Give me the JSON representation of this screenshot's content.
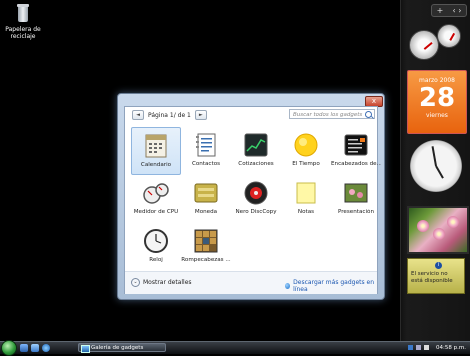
{
  "desktop": {
    "recycle_bin_label": "Papelera de reciclaje"
  },
  "sidebar": {
    "controls": {
      "add": "+",
      "nav": "‹ ›"
    },
    "calendar": {
      "month": "marzo 2008",
      "day": "28",
      "weekday": "viernes"
    },
    "weather_message": "El servicio no está disponible"
  },
  "gallery": {
    "close_label": "x",
    "pager": {
      "prev": "◄",
      "label": "Página 1/ de 1",
      "next": "►"
    },
    "search_placeholder": "Buscar todos los gadgets",
    "gadgets": [
      {
        "name": "Calendario",
        "icon": "calendar-icon",
        "selected": true
      },
      {
        "name": "Contactos",
        "icon": "contacts-icon",
        "selected": false
      },
      {
        "name": "Cotizaciones",
        "icon": "stocks-icon",
        "selected": false
      },
      {
        "name": "El Tiempo",
        "icon": "weather-icon",
        "selected": false
      },
      {
        "name": "Encabezados de...",
        "icon": "headlines-icon",
        "selected": false
      },
      {
        "name": "Medidor de CPU",
        "icon": "cpu-meter-icon",
        "selected": false
      },
      {
        "name": "Moneda",
        "icon": "currency-icon",
        "selected": false
      },
      {
        "name": "Nero DiscCopy",
        "icon": "disc-icon",
        "selected": false
      },
      {
        "name": "Notas",
        "icon": "notes-icon",
        "selected": false
      },
      {
        "name": "Presentación",
        "icon": "slideshow-icon",
        "selected": false
      },
      {
        "name": "Reloj",
        "icon": "clock-icon",
        "selected": false
      },
      {
        "name": "Rompecabezas ...",
        "icon": "puzzle-icon",
        "selected": false
      }
    ],
    "details_label": "Mostrar detalles",
    "more_gadgets_link": "Descargar más gadgets en línea"
  },
  "taskbar": {
    "window_button": "Galería de gadgets",
    "time": "04:58 p.m."
  }
}
